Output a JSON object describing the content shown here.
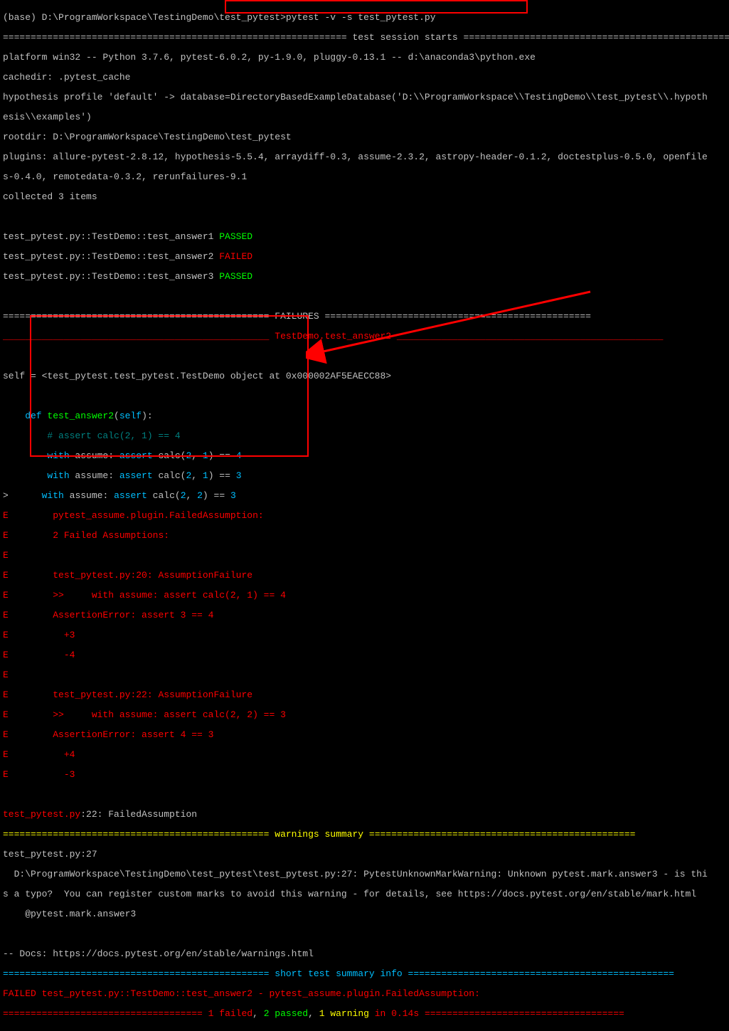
{
  "prompt": {
    "prefix": "(base) D:\\ProgramWorkspace\\TestingDemo\\test_pytest>",
    "command": "pytest -v -s test_pytest.py"
  },
  "session": {
    "rule": "==============================================================",
    "label": " test session starts ",
    "platform": "platform win32 -- Python 3.7.6, pytest-6.0.2, py-1.9.0, pluggy-0.13.1 -- d:\\anaconda3\\python.exe",
    "cachedir": "cachedir: .pytest_cache",
    "hypothesis1": "hypothesis profile 'default' -> database=DirectoryBasedExampleDatabase('D:\\\\ProgramWorkspace\\\\TestingDemo\\\\test_pytest\\\\.hypoth",
    "hypothesis2": "esis\\\\examples')",
    "rootdir": "rootdir: D:\\ProgramWorkspace\\TestingDemo\\test_pytest",
    "plugins1": "plugins: allure-pytest-2.8.12, hypothesis-5.5.4, arraydiff-0.3, assume-2.3.2, astropy-header-0.1.2, doctestplus-0.5.0, openfile",
    "plugins2": "s-0.4.0, remotedata-0.3.2, rerunfailures-9.1",
    "collected": "collected 3 items"
  },
  "tests": {
    "t1_name": "test_pytest.py::TestDemo::test_answer1 ",
    "t1_status": "PASSED",
    "t2_name": "test_pytest.py::TestDemo::test_answer2 ",
    "t2_status": "FAILED",
    "t3_name": "test_pytest.py::TestDemo::test_answer3 ",
    "t3_status": "PASSED"
  },
  "failures": {
    "rule_l": "================================================",
    "rule_r": "================================================",
    "label": " FAILURES ",
    "rulef_l": "________________________________________________",
    "rulef_r": "________________________________________________",
    "name": " TestDemo.test_answer2 ",
    "self": "self = <test_pytest.test_pytest.TestDemo object at 0x000002AF5EAECC88>",
    "def": "    def",
    "funcname": " test_answer2",
    "params": "(",
    "selfkw": "self",
    "paramsend": "):",
    "comment": "        # assert calc(2, 1) == 4",
    "withkw": "        with",
    "gap0": " assume: ",
    "assertkw": "assert",
    "call_a": " calc(",
    "n2": "2",
    "comma": ", ",
    "n1": "1",
    "n2b": "2",
    "close_eq": ") == ",
    "n4": "4",
    "n3": "3",
    "plug1": "        pytest_assume.plugin.FailedAssumption:",
    "plug2": "        2 Failed Assumptions:",
    "blank": "",
    "af1": "        test_pytest.py:20: AssumptionFailure",
    "af1a": "        >>\twith assume: assert calc(2, 1) == 4",
    "af1b": "        AssertionError: assert 3 == 4",
    "plus3": "          +3",
    "minus4": "          -4",
    "af2": "        test_pytest.py:22: AssumptionFailure",
    "af2a": "        >>\twith assume: assert calc(2, 2) == 3",
    "af2b": "        AssertionError: assert 4 == 3",
    "plus4": "          +4",
    "minus3": "          -3",
    "E": "E",
    ">": ">",
    "finalloc": "test_pytest.py",
    "finalcolon": ":22: FailedAssumption"
  },
  "warnings": {
    "rule_l": "================================================",
    "rule_r": "================================================",
    "label": " warnings summary ",
    "l1": "test_pytest.py:27",
    "l2": "  D:\\ProgramWorkspace\\TestingDemo\\test_pytest\\test_pytest.py:27: PytestUnknownMarkWarning: Unknown pytest.mark.answer3 - is thi",
    "l3": "s a typo?  You can register custom marks to avoid this warning - for details, see https://docs.pytest.org/en/stable/mark.html",
    "l4": "    @pytest.mark.answer3",
    "l5": "",
    "l6": "-- Docs: https://docs.pytest.org/en/stable/warnings.html"
  },
  "summary": {
    "rule_l": "================================================",
    "rule_r": "================================================",
    "label": " short test summary info ",
    "failedline": "FAILED test_pytest.py::TestDemo::test_answer2 - pytest_assume.plugin.FailedAssumption:",
    "final_rule_l": "====================================",
    "final_rule_r": "====================================",
    "final_failed": " 1 failed",
    "final_sep1": ", ",
    "final_passed": "2 passed",
    "final_sep2": ", ",
    "final_warn": "1 warning",
    "final_time": " in 0.14s "
  }
}
